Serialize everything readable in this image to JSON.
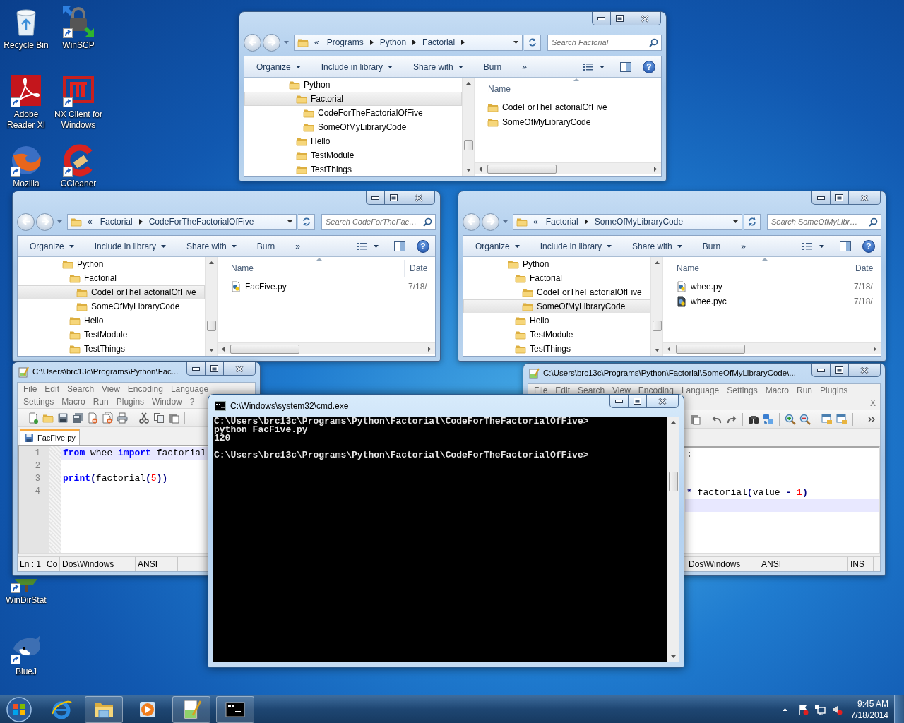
{
  "desktop_icons": [
    {
      "kind": "recycle-bin",
      "label": "Recycle Bin",
      "shortcut": false
    },
    {
      "kind": "winscp",
      "label": "WinSCP",
      "shortcut": true
    },
    {
      "kind": "acrobat",
      "label": "Adobe Reader XI",
      "shortcut": true
    },
    {
      "kind": "nx",
      "label": "NX Client for Windows",
      "shortcut": true
    },
    {
      "kind": "firefox",
      "label": "Mozilla",
      "shortcut": true
    },
    {
      "kind": "ccleaner",
      "label": "CCleaner",
      "shortcut": true
    },
    {
      "kind": "windirstat",
      "label": "WinDirStat",
      "shortcut": true
    },
    {
      "kind": "bluej",
      "label": "BlueJ",
      "shortcut": true
    }
  ],
  "explorer_windows": [
    {
      "address": {
        "overflow": "«",
        "crumbs": [
          "Programs",
          "Python",
          "Factorial"
        ],
        "has_subfolders": true
      },
      "search": {
        "placeholder": "Search Factorial"
      },
      "toolbar": [
        {
          "label": "Organize",
          "menu": true
        },
        {
          "label": "Include in library",
          "menu": true
        },
        {
          "label": "Share with",
          "menu": true
        },
        {
          "label": "Burn",
          "menu": false
        },
        {
          "label": "»",
          "menu": false
        }
      ],
      "help_button": "?",
      "tree": [
        {
          "label": "Python",
          "selected": false,
          "children": [
            {
              "label": "Factorial",
              "selected": true,
              "children": [
                {
                  "label": "CodeForTheFactorialOfFive",
                  "selected": false
                },
                {
                  "label": "SomeOfMyLibraryCode",
                  "selected": false
                }
              ]
            },
            {
              "label": "Hello",
              "selected": false
            },
            {
              "label": "TestModule",
              "selected": false
            },
            {
              "label": "TestThings",
              "selected": false
            }
          ]
        }
      ],
      "columns": [
        "Name"
      ],
      "files": [
        {
          "kind": "folder",
          "name": "CodeForTheFactorialOfFive"
        },
        {
          "kind": "folder",
          "name": "SomeOfMyLibraryCode"
        }
      ]
    },
    {
      "address": {
        "overflow": "«",
        "crumbs": [
          "Factorial",
          "CodeForTheFactorialOfFive"
        ],
        "has_subfolders": false
      },
      "search": {
        "placeholder": "Search CodeForTheFac…"
      },
      "toolbar": [
        {
          "label": "Organize",
          "menu": true
        },
        {
          "label": "Include in library",
          "menu": true
        },
        {
          "label": "Share with",
          "menu": true
        },
        {
          "label": "Burn",
          "menu": false
        },
        {
          "label": "»",
          "menu": false
        }
      ],
      "help_button": "?",
      "tree": [
        {
          "label": "Python",
          "selected": false,
          "children": [
            {
              "label": "Factorial",
              "selected": false,
              "children": [
                {
                  "label": "CodeForTheFactorialOfFive",
                  "selected": true
                },
                {
                  "label": "SomeOfMyLibraryCode",
                  "selected": false
                }
              ]
            },
            {
              "label": "Hello",
              "selected": false
            },
            {
              "label": "TestModule",
              "selected": false
            },
            {
              "label": "TestThings",
              "selected": false
            }
          ]
        }
      ],
      "columns": [
        "Name",
        "Date"
      ],
      "files": [
        {
          "kind": "py",
          "name": "FacFive.py",
          "date": "7/18/"
        }
      ]
    },
    {
      "address": {
        "overflow": "«",
        "crumbs": [
          "Factorial",
          "SomeOfMyLibraryCode"
        ],
        "has_subfolders": false
      },
      "search": {
        "placeholder": "Search SomeOfMyLibr…"
      },
      "toolbar": [
        {
          "label": "Organize",
          "menu": true
        },
        {
          "label": "Include in library",
          "menu": true
        },
        {
          "label": "Share with",
          "menu": true
        },
        {
          "label": "Burn",
          "menu": false
        },
        {
          "label": "»",
          "menu": false
        }
      ],
      "help_button": "?",
      "tree": [
        {
          "label": "Python",
          "selected": false,
          "children": [
            {
              "label": "Factorial",
              "selected": false,
              "children": [
                {
                  "label": "CodeForTheFactorialOfFive",
                  "selected": false
                },
                {
                  "label": "SomeOfMyLibraryCode",
                  "selected": true
                }
              ]
            },
            {
              "label": "Hello",
              "selected": false
            },
            {
              "label": "TestModule",
              "selected": false
            },
            {
              "label": "TestThings",
              "selected": false
            }
          ]
        }
      ],
      "columns": [
        "Name",
        "Date"
      ],
      "files": [
        {
          "kind": "py",
          "name": "whee.py",
          "date": "7/18/"
        },
        {
          "kind": "pyc",
          "name": "whee.pyc",
          "date": "7/18/"
        }
      ]
    }
  ],
  "notepad_windows": [
    {
      "title": "C:\\Users\\brc13c\\Programs\\Python\\Fac...",
      "menu_rows": [
        [
          "File",
          "Edit",
          "Search",
          "View",
          "Encoding",
          "Language"
        ],
        [
          "Settings",
          "Macro",
          "Run",
          "Plugins",
          "Window",
          "?"
        ]
      ],
      "tabs": [
        {
          "label": "FacFive.py",
          "selected": true
        }
      ],
      "lines": [
        {
          "number": "1",
          "current": true,
          "tokens": [
            {
              "kind": "keyword",
              "text": "from"
            },
            {
              "kind": "plain",
              "text": " whee "
            },
            {
              "kind": "keyword",
              "text": "import"
            },
            {
              "kind": "plain",
              "text": " factorial"
            }
          ]
        },
        {
          "number": "2",
          "current": false
        },
        {
          "number": "3",
          "current": false,
          "tokens": [
            {
              "kind": "keyword",
              "text": "print"
            },
            {
              "kind": "operator",
              "text": "("
            },
            {
              "kind": "plain",
              "text": "factorial"
            },
            {
              "kind": "operator",
              "text": "("
            },
            {
              "kind": "number",
              "text": "5"
            },
            {
              "kind": "operator",
              "text": "))"
            }
          ]
        },
        {
          "number": "4",
          "current": false
        }
      ],
      "status": [
        "Ln : 1",
        "Co",
        "Dos\\Windows",
        "ANSI"
      ]
    },
    {
      "title": "C:\\Users\\brc13c\\Programs\\Python\\Factorial\\SomeOfMyLibraryCode\\...",
      "menu_rows": [
        [
          "File",
          "Edit",
          "Search",
          "View",
          "Encoding",
          "Language",
          "Settings",
          "Macro",
          "Run",
          "Plugins"
        ]
      ],
      "close_document": "X",
      "lines": [
        {
          "current": false,
          "tokens": [
            {
              "kind": "plain",
              "text": ":"
            }
          ]
        },
        {
          "current": false
        },
        {
          "current": false
        },
        {
          "current": false,
          "tokens": [
            {
              "kind": "operator",
              "text": "*"
            },
            {
              "kind": "plain",
              "text": " factorial"
            },
            {
              "kind": "operator",
              "text": "("
            },
            {
              "kind": "plain",
              "text": "value "
            },
            {
              "kind": "operator",
              "text": "- "
            },
            {
              "kind": "number",
              "text": "1"
            },
            {
              "kind": "operator",
              "text": ")"
            }
          ]
        },
        {
          "current": true
        }
      ],
      "status": [
        "Dos\\Windows",
        "ANSI",
        "INS"
      ]
    }
  ],
  "console_window": {
    "title": "C:\\Windows\\system32\\cmd.exe",
    "blocks": [
      [
        "C:\\Users\\brc13c\\Programs\\Python\\Factorial\\CodeForTheFactorialOfFive>",
        "python FacFive.py",
        "120"
      ],
      [
        "C:\\Users\\brc13c\\Programs\\Python\\Factorial\\CodeForTheFactorialOfFive>"
      ]
    ]
  },
  "taskbar": {
    "items": [
      {
        "kind": "ie",
        "open": false
      },
      {
        "kind": "explorer",
        "open": true
      },
      {
        "kind": "media-player",
        "open": false
      },
      {
        "kind": "notepad",
        "open": true
      },
      {
        "kind": "console",
        "open": true
      }
    ],
    "clock": {
      "time": "9:45 AM",
      "date": "7/18/2014"
    }
  }
}
